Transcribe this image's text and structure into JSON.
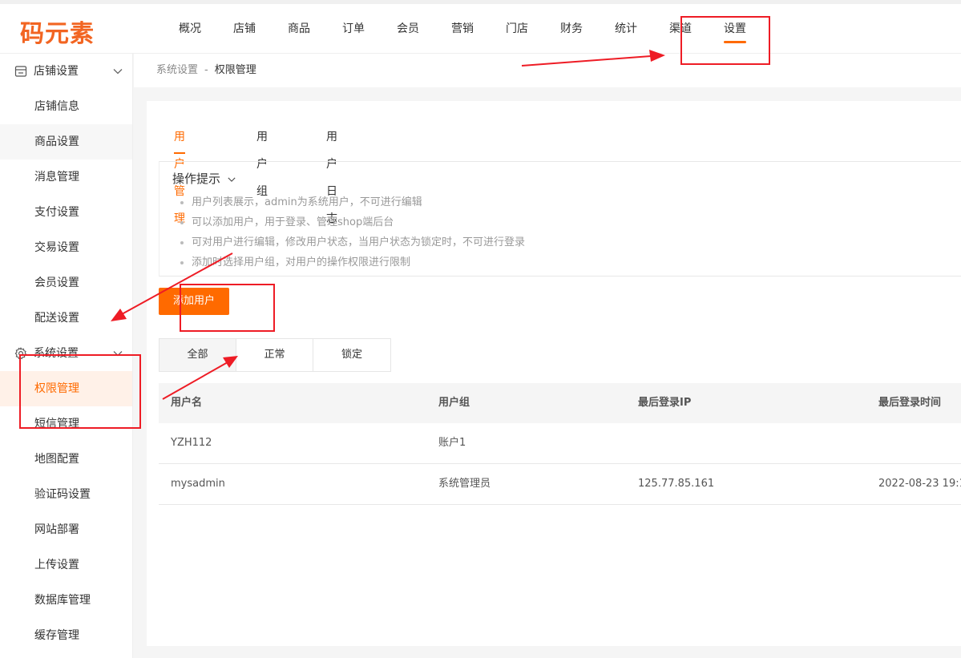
{
  "logo": "码元素",
  "nav": {
    "items": [
      "概况",
      "店铺",
      "商品",
      "订单",
      "会员",
      "营销",
      "门店",
      "财务",
      "统计",
      "渠道",
      "设置"
    ],
    "active_index": 10
  },
  "sidebar": {
    "groups": [
      {
        "label": "店铺设置",
        "icon": "store-icon",
        "items": [
          "店铺信息",
          "商品设置",
          "消息管理",
          "支付设置",
          "交易设置",
          "会员设置",
          "配送设置"
        ]
      },
      {
        "label": "系统设置",
        "icon": "gear-icon",
        "items": [
          "权限管理",
          "短信管理",
          "地图配置",
          "验证码设置",
          "网站部署",
          "上传设置",
          "数据库管理",
          "缓存管理"
        ]
      }
    ],
    "active_item": "权限管理"
  },
  "breadcrumb": {
    "parent": "系统设置",
    "separator": "-",
    "current": "权限管理"
  },
  "tabs": [
    "用户管理",
    "用户组",
    "用户日志"
  ],
  "tips": {
    "title": "操作提示",
    "items": [
      "用户列表展示，admin为系统用户，不可进行编辑",
      "可以添加用户，用于登录、管理shop端后台",
      "可对用户进行编辑，修改用户状态，当用户状态为锁定时，不可进行登录",
      "添加时选择用户组，对用户的操作权限进行限制"
    ]
  },
  "add_button": "添加用户",
  "filters": [
    "全部",
    "正常",
    "锁定"
  ],
  "table": {
    "headers": [
      "用户名",
      "用户组",
      "最后登录IP",
      "最后登录时间"
    ],
    "rows": [
      [
        "YZH112",
        "账户1",
        "",
        ""
      ],
      [
        "mysadmin",
        "系统管理员",
        "125.77.85.161",
        "2022-08-23 19:1"
      ]
    ]
  },
  "colors": {
    "accent": "#ff6a00",
    "annotation": "#ee1c25"
  }
}
